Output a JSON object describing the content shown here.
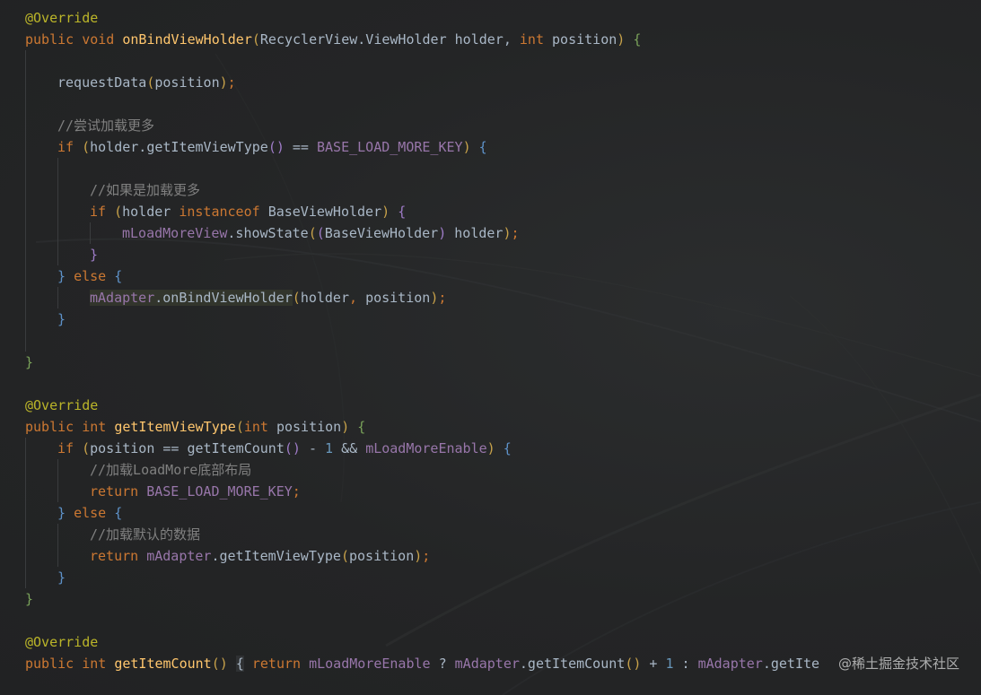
{
  "lines": [
    {
      "indent": 0,
      "tokens": [
        {
          "c": "ann",
          "t": "@Override"
        }
      ]
    },
    {
      "indent": 0,
      "tokens": [
        {
          "c": "kw",
          "t": "public void "
        },
        {
          "c": "fn",
          "t": "onBindViewHolder"
        },
        {
          "c": "p1",
          "t": "("
        },
        {
          "c": "txt",
          "t": "RecyclerView.ViewHolder holder, "
        },
        {
          "c": "kw",
          "t": "int "
        },
        {
          "c": "txt",
          "t": "position"
        },
        {
          "c": "p1",
          "t": ")"
        },
        {
          "c": "txt",
          "t": " "
        },
        {
          "c": "p4",
          "t": "{"
        }
      ]
    },
    {
      "indent": 1,
      "tokens": []
    },
    {
      "indent": 1,
      "tokens": [
        {
          "c": "txt",
          "t": "requestData"
        },
        {
          "c": "p1",
          "t": "("
        },
        {
          "c": "txt",
          "t": "position"
        },
        {
          "c": "p1",
          "t": ")"
        },
        {
          "c": "kw",
          "t": ";"
        }
      ]
    },
    {
      "indent": 1,
      "tokens": []
    },
    {
      "indent": 1,
      "tokens": [
        {
          "c": "cmt",
          "t": "//尝试加载更多"
        }
      ]
    },
    {
      "indent": 1,
      "tokens": [
        {
          "c": "kw",
          "t": "if "
        },
        {
          "c": "p1",
          "t": "("
        },
        {
          "c": "txt",
          "t": "holder.getItemViewType"
        },
        {
          "c": "p2",
          "t": "()"
        },
        {
          "c": "txt",
          "t": " == "
        },
        {
          "c": "fld",
          "t": "BASE_LOAD_MORE_KEY"
        },
        {
          "c": "p1",
          "t": ")"
        },
        {
          "c": "txt",
          "t": " "
        },
        {
          "c": "p3",
          "t": "{"
        }
      ]
    },
    {
      "indent": 2,
      "tokens": []
    },
    {
      "indent": 2,
      "tokens": [
        {
          "c": "cmt",
          "t": "//如果是加载更多"
        }
      ]
    },
    {
      "indent": 2,
      "tokens": [
        {
          "c": "kw",
          "t": "if "
        },
        {
          "c": "p1",
          "t": "("
        },
        {
          "c": "txt",
          "t": "holder "
        },
        {
          "c": "kw",
          "t": "instanceof "
        },
        {
          "c": "txt",
          "t": "BaseViewHolder"
        },
        {
          "c": "p1",
          "t": ")"
        },
        {
          "c": "txt",
          "t": " "
        },
        {
          "c": "p2",
          "t": "{"
        }
      ]
    },
    {
      "indent": 3,
      "tokens": [
        {
          "c": "fld",
          "t": "mLoadMoreView"
        },
        {
          "c": "txt",
          "t": ".showState"
        },
        {
          "c": "p1",
          "t": "("
        },
        {
          "c": "p2",
          "t": "("
        },
        {
          "c": "txt",
          "t": "BaseViewHolder"
        },
        {
          "c": "p2",
          "t": ")"
        },
        {
          "c": "txt",
          "t": " holder"
        },
        {
          "c": "p1",
          "t": ")"
        },
        {
          "c": "kw",
          "t": ";"
        }
      ]
    },
    {
      "indent": 2,
      "tokens": [
        {
          "c": "p2",
          "t": "}"
        }
      ]
    },
    {
      "indent": 1,
      "tokens": [
        {
          "c": "p3",
          "t": "}"
        },
        {
          "c": "txt",
          "t": " "
        },
        {
          "c": "kw",
          "t": "else "
        },
        {
          "c": "p3",
          "t": "{"
        }
      ]
    },
    {
      "indent": 2,
      "tokens": [
        {
          "c": "fld",
          "t": "mAdapter",
          "hl": "code"
        },
        {
          "c": "txt",
          "t": ".onBindViewHolder",
          "hl": "code"
        },
        {
          "c": "p1",
          "t": "("
        },
        {
          "c": "txt",
          "t": "holder"
        },
        {
          "c": "kw",
          "t": ", "
        },
        {
          "c": "txt",
          "t": "position"
        },
        {
          "c": "p1",
          "t": ")"
        },
        {
          "c": "kw",
          "t": ";"
        }
      ]
    },
    {
      "indent": 1,
      "tokens": [
        {
          "c": "p3",
          "t": "}"
        }
      ]
    },
    {
      "indent": 1,
      "tokens": []
    },
    {
      "indent": 0,
      "tokens": [
        {
          "c": "p4",
          "t": "}"
        }
      ]
    },
    {
      "indent": 0,
      "tokens": []
    },
    {
      "indent": 0,
      "tokens": [
        {
          "c": "ann",
          "t": "@Override"
        }
      ]
    },
    {
      "indent": 0,
      "tokens": [
        {
          "c": "kw",
          "t": "public int "
        },
        {
          "c": "fn",
          "t": "getItemViewType"
        },
        {
          "c": "p1",
          "t": "("
        },
        {
          "c": "kw",
          "t": "int "
        },
        {
          "c": "txt",
          "t": "position"
        },
        {
          "c": "p1",
          "t": ")"
        },
        {
          "c": "txt",
          "t": " "
        },
        {
          "c": "p4",
          "t": "{"
        }
      ]
    },
    {
      "indent": 1,
      "tokens": [
        {
          "c": "kw",
          "t": "if "
        },
        {
          "c": "p1",
          "t": "("
        },
        {
          "c": "txt",
          "t": "position == getItemCount"
        },
        {
          "c": "p2",
          "t": "()"
        },
        {
          "c": "txt",
          "t": " - "
        },
        {
          "c": "num",
          "t": "1"
        },
        {
          "c": "txt",
          "t": " && "
        },
        {
          "c": "fld",
          "t": "mLoadMoreEnable"
        },
        {
          "c": "p1",
          "t": ")"
        },
        {
          "c": "txt",
          "t": " "
        },
        {
          "c": "p3",
          "t": "{"
        }
      ]
    },
    {
      "indent": 2,
      "tokens": [
        {
          "c": "cmt",
          "t": "//加载LoadMore底部布局"
        }
      ]
    },
    {
      "indent": 2,
      "tokens": [
        {
          "c": "kw",
          "t": "return "
        },
        {
          "c": "fld",
          "t": "BASE_LOAD_MORE_KEY"
        },
        {
          "c": "kw",
          "t": ";"
        }
      ]
    },
    {
      "indent": 1,
      "tokens": [
        {
          "c": "p3",
          "t": "}"
        },
        {
          "c": "txt",
          "t": " "
        },
        {
          "c": "kw",
          "t": "else "
        },
        {
          "c": "p3",
          "t": "{"
        }
      ]
    },
    {
      "indent": 2,
      "tokens": [
        {
          "c": "cmt",
          "t": "//加载默认的数据"
        }
      ]
    },
    {
      "indent": 2,
      "tokens": [
        {
          "c": "kw",
          "t": "return "
        },
        {
          "c": "fld",
          "t": "mAdapter"
        },
        {
          "c": "txt",
          "t": ".getItemViewType"
        },
        {
          "c": "p1",
          "t": "("
        },
        {
          "c": "txt",
          "t": "position"
        },
        {
          "c": "p1",
          "t": ")"
        },
        {
          "c": "kw",
          "t": ";"
        }
      ]
    },
    {
      "indent": 1,
      "tokens": [
        {
          "c": "p3",
          "t": "}"
        }
      ]
    },
    {
      "indent": 0,
      "tokens": [
        {
          "c": "p4",
          "t": "}"
        }
      ]
    },
    {
      "indent": 0,
      "tokens": []
    },
    {
      "indent": 0,
      "tokens": [
        {
          "c": "ann",
          "t": "@Override"
        }
      ]
    },
    {
      "indent": 0,
      "tokens": [
        {
          "c": "kw",
          "t": "public int "
        },
        {
          "c": "fn",
          "t": "getItemCount"
        },
        {
          "c": "p1",
          "t": "()"
        },
        {
          "c": "txt",
          "t": " "
        },
        {
          "c": "txt",
          "t": "{",
          "hl": "brace"
        },
        {
          "c": "txt",
          "t": " "
        },
        {
          "c": "kw",
          "t": "return "
        },
        {
          "c": "fld",
          "t": "mLoadMoreEnable"
        },
        {
          "c": "txt",
          "t": " ? "
        },
        {
          "c": "fld",
          "t": "mAdapter"
        },
        {
          "c": "txt",
          "t": ".getItemCount"
        },
        {
          "c": "p1",
          "t": "()"
        },
        {
          "c": "txt",
          "t": " + "
        },
        {
          "c": "num",
          "t": "1"
        },
        {
          "c": "txt",
          "t": " : "
        },
        {
          "c": "fld",
          "t": "mAdapter"
        },
        {
          "c": "txt",
          "t": ".getIte"
        }
      ]
    }
  ],
  "watermark": "@稀土掘金技术社区",
  "colors": {
    "background": "#232425",
    "keyword": "#cc7832",
    "function": "#ffc66d",
    "field": "#9876aa",
    "comment": "#808080",
    "annotation": "#bbb529",
    "number": "#6897bb",
    "text": "#a9b7c6"
  }
}
